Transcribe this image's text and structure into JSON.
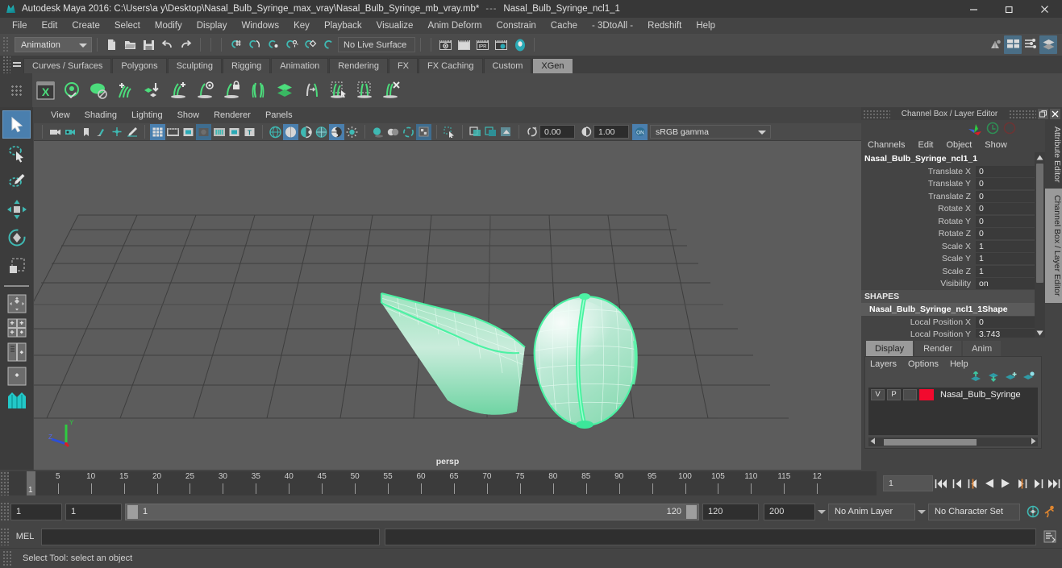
{
  "window": {
    "title": "Autodesk Maya 2016: C:\\Users\\a y\\Desktop\\Nasal_Bulb_Syringe_max_vray\\Nasal_Bulb_Syringe_mb_vray.mb*",
    "separator": "---",
    "subtitle": "Nasal_Bulb_Syringe_ncl1_1",
    "minimize": "minimize-button",
    "maximize": "restore-button",
    "close": "close-button"
  },
  "menubar": {
    "items": [
      "File",
      "Edit",
      "Create",
      "Select",
      "Modify",
      "Display",
      "Windows",
      "Key",
      "Playback",
      "Visualize",
      "Anim Deform",
      "Constrain",
      "Cache",
      "- 3DtoAll -",
      "Redshift",
      "Help"
    ]
  },
  "statusbar": {
    "mode": "Animation",
    "live_surface": "No Live Surface",
    "snap_icons": [
      "snap-to-grid-icon",
      "snap-to-curve-icon",
      "snap-to-point-icon",
      "snap-to-projected-center-icon",
      "snap-to-view-plane-icon",
      "make-live-icon"
    ],
    "file_icons": [
      "new-scene-icon",
      "open-scene-icon",
      "save-scene-icon",
      "undo-icon",
      "redo-icon"
    ],
    "render_icons": [
      "render-current-frame-icon",
      "render-sequence-icon",
      "ipr-render-icon",
      "render-settings-icon",
      "hypershade-icon"
    ],
    "right_icons": [
      "show-manipulator-icon",
      "attribute-editor-icon",
      "tool-settings-icon",
      "channel-box-icon"
    ]
  },
  "shelf": {
    "tabs": [
      "Curves / Surfaces",
      "Polygons",
      "Sculpting",
      "Rigging",
      "Animation",
      "Rendering",
      "FX",
      "FX Caching",
      "Custom",
      "XGen"
    ],
    "active_tab": "XGen",
    "icons": [
      "xgen-editor-icon",
      "xgen-preview-icon",
      "xgen-hide-preview-icon",
      "xgen-add-grooming-icon",
      "xgen-import-collection-icon",
      "xgen-create-description-icon",
      "xgen-description-visibility-icon",
      "xgen-lock-description-icon",
      "xgen-groom-brush-icon",
      "xgen-layers-icon",
      "xgen-convert-to-interactive-icon",
      "xgen-select-guides-icon",
      "xgen-clear-guides-icon",
      "xgen-delete-guides-icon"
    ]
  },
  "toolbox": {
    "items": [
      "select-tool",
      "lasso-select-tool",
      "paint-select-tool",
      "move-tool",
      "rotate-tool",
      "scale-tool",
      "last-tool-used",
      "four-view-layout",
      "quad-view-layout",
      "outliner-persp-layout",
      "persp-graph-layout",
      "hypershade-persp-layout"
    ],
    "selected": "select-tool"
  },
  "viewport": {
    "menus": [
      "View",
      "Shading",
      "Lighting",
      "Show",
      "Renderer",
      "Panels"
    ],
    "camera_label": "persp",
    "exposure": "0.00",
    "gamma": "1.00",
    "color_management": "sRGB gamma",
    "toolbar_icons": [
      "select-camera-icon",
      "lock-camera-icon",
      "bookmark-icon",
      "image-plane-icon",
      "two-d-pan-zoom-icon",
      "grease-pencil-icon",
      "grid-toggle-icon",
      "film-gate-icon",
      "resolution-gate-icon",
      "gate-mask-icon",
      "field-chart-icon",
      "safe-action-icon",
      "safe-title-icon",
      "wireframe-icon",
      "smooth-shade-icon",
      "shade-options-icon",
      "wireframe-on-shaded-icon",
      "texture-icon",
      "lighting-icon",
      "shadows-icon",
      "screen-space-ao-icon",
      "motion-blur-icon",
      "multisample-icon",
      "depth-of-field-icon",
      "isolate-select-icon",
      "xray-icon",
      "xray-joints-icon",
      "xray-active-components-icon",
      "exposure-icon",
      "gamma-icon",
      "view-transform-icon"
    ],
    "axis": {
      "x": "X",
      "y": "Y",
      "z": "Z"
    }
  },
  "channelbox": {
    "panel_title": "Channel Box / Layer Editor",
    "menus": [
      "Channels",
      "Edit",
      "Object",
      "Show"
    ],
    "node_name": "Nasal_Bulb_Syringe_ncl1_1",
    "transform_attrs": [
      {
        "label": "Translate X",
        "value": "0"
      },
      {
        "label": "Translate Y",
        "value": "0"
      },
      {
        "label": "Translate Z",
        "value": "0"
      },
      {
        "label": "Rotate X",
        "value": "0"
      },
      {
        "label": "Rotate Y",
        "value": "0"
      },
      {
        "label": "Rotate Z",
        "value": "0"
      },
      {
        "label": "Scale X",
        "value": "1"
      },
      {
        "label": "Scale Y",
        "value": "1"
      },
      {
        "label": "Scale Z",
        "value": "1"
      },
      {
        "label": "Visibility",
        "value": "on"
      }
    ],
    "shapes_header": "SHAPES",
    "shape_name": "Nasal_Bulb_Syringe_ncl1_1Shape",
    "shape_attrs": [
      {
        "label": "Local Position X",
        "value": "0"
      },
      {
        "label": "Local Position Y",
        "value": "3.743"
      }
    ]
  },
  "layereditor": {
    "tabs": [
      "Display",
      "Render",
      "Anim"
    ],
    "active_tab": "Display",
    "menus": [
      "Layers",
      "Options",
      "Help"
    ],
    "toolbar_icons": [
      "move-layer-up-icon",
      "move-layer-down-icon",
      "new-layer-icon",
      "new-layer-from-selected-icon"
    ],
    "layers": [
      {
        "visibility": "V",
        "playback": "P",
        "type": "",
        "color": "#f20a2e",
        "name": "Nasal_Bulb_Syringe"
      }
    ]
  },
  "sidetabs": {
    "items": [
      "Attribute Editor",
      "Channel Box / Layer Editor"
    ],
    "active": "Channel Box / Layer Editor"
  },
  "timeline": {
    "current_frame_marker": "1",
    "tick_labels": [
      "5",
      "10",
      "15",
      "20",
      "25",
      "30",
      "35",
      "40",
      "45",
      "50",
      "55",
      "60",
      "65",
      "70",
      "75",
      "80",
      "85",
      "90",
      "95",
      "100",
      "105",
      "110",
      "115",
      "12"
    ],
    "current_frame_field": "1",
    "playback_buttons": [
      "go-to-start-icon",
      "step-back-keyframe-icon",
      "step-back-frame-icon",
      "play-backwards-icon",
      "play-forwards-icon",
      "step-forward-frame-icon",
      "step-forward-keyframe-icon",
      "go-to-end-icon"
    ]
  },
  "range": {
    "anim_start": "1",
    "range_start": "1",
    "slider_start_label": "1",
    "slider_end_label": "120",
    "range_end": "120",
    "anim_end": "200",
    "anim_layer": "No Anim Layer",
    "character_set": "No Character Set",
    "auto_key_icon": "auto-keyframe-icon",
    "anim_prefs_icon": "animation-preferences-icon"
  },
  "mel": {
    "label": "MEL",
    "command_value": "",
    "output_value": "",
    "script_editor_icon": "script-editor-icon"
  },
  "help": {
    "text": "Select Tool: select an object"
  },
  "colors": {
    "accent_blue": "#4a7fae",
    "shelf_green": "#4caf6a",
    "selection_green": "#5df2a0",
    "layer_red": "#f20a2e",
    "teal": "#2aa9b5"
  }
}
